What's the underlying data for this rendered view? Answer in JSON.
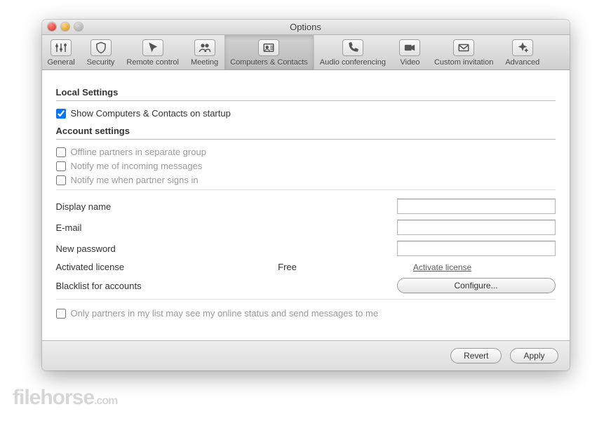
{
  "window": {
    "title": "Options"
  },
  "toolbar": {
    "items": [
      {
        "id": "general",
        "label": "General"
      },
      {
        "id": "security",
        "label": "Security"
      },
      {
        "id": "remote-control",
        "label": "Remote control"
      },
      {
        "id": "meeting",
        "label": "Meeting"
      },
      {
        "id": "computers-contacts",
        "label": "Computers & Contacts"
      },
      {
        "id": "audio-conferencing",
        "label": "Audio conferencing"
      },
      {
        "id": "video",
        "label": "Video"
      },
      {
        "id": "custom-invitation",
        "label": "Custom invitation"
      },
      {
        "id": "advanced",
        "label": "Advanced"
      }
    ]
  },
  "sections": {
    "local_head": "Local Settings",
    "account_head": "Account settings",
    "show_on_startup": "Show Computers & Contacts on startup",
    "offline_group": "Offline partners in separate group",
    "notify_incoming": "Notify me of incoming messages",
    "notify_signin": "Notify me when partner signs in",
    "display_name_label": "Display name",
    "email_label": "E-mail",
    "new_pw_label": "New password",
    "activated_label": "Activated license",
    "activated_value": "Free",
    "activate_link": "Activate license",
    "blacklist_label": "Blacklist for accounts",
    "configure_btn": "Configure...",
    "only_partners": "Only partners in my list may see my online status and send messages to me",
    "display_name_value": "",
    "email_value": "",
    "new_pw_value": ""
  },
  "footer": {
    "revert": "Revert",
    "apply": "Apply"
  },
  "watermark": {
    "a": "filehorse",
    "b": ".com"
  }
}
